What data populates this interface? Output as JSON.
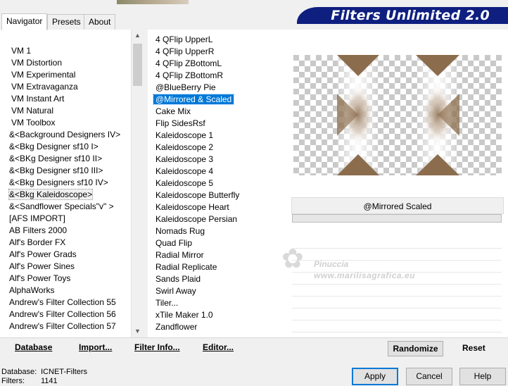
{
  "tabs": [
    {
      "label": "Navigator"
    },
    {
      "label": "Presets"
    },
    {
      "label": "About"
    }
  ],
  "app_title": "Filters Unlimited 2.0",
  "categories": [
    "VM 1",
    "VM Distortion",
    "VM Experimental",
    "VM Extravaganza",
    "VM Instant Art",
    "VM Natural",
    "VM Toolbox",
    "&<Background Designers IV>",
    "&<Bkg Designer sf10 I>",
    "&<BKg Designer sf10 II>",
    "&<Bkg Designer sf10 III>",
    "&<Bkg Designers sf10 IV>",
    "&<Bkg Kaleidoscope>",
    "&<Sandflower Specials\"v\" >",
    "[AFS IMPORT]",
    "AB Filters 2000",
    "Alf's Border FX",
    "Alf's Power Grads",
    "Alf's Power Sines",
    "Alf's Power Toys",
    "AlphaWorks",
    "Andrew's Filter Collection 55",
    "Andrew's Filter Collection 56",
    "Andrew's Filter Collection 57"
  ],
  "selected_category": "&<Bkg Kaleidoscope>",
  "filters": [
    "4 QFlip UpperL",
    "4 QFlip UpperR",
    "4 QFlip ZBottomL",
    "4 QFlip ZBottomR",
    "@BlueBerry Pie",
    "@Mirrored & Scaled",
    "Cake Mix",
    "Flip SidesRsf",
    "Kaleidoscope 1",
    "Kaleidoscope 2",
    "Kaleidoscope 3",
    "Kaleidoscope 4",
    "Kaleidoscope 5",
    "Kaleidoscope Butterfly",
    "Kaleidoscope Heart",
    "Kaleidoscope Persian",
    "Nomads Rug",
    "Quad Flip",
    "Radial Mirror",
    "Radial Replicate",
    "Sands Plaid",
    "Swirl Away",
    "Tiler...",
    "xTile Maker 1.0",
    "Zandflower"
  ],
  "selected_filter": "@Mirrored & Scaled",
  "preview_caption": "@Mirrored  Scaled",
  "watermark": {
    "name": "Pinuccia",
    "url": "www.marilisagrafica.eu"
  },
  "bottom_links": {
    "database": "Database",
    "import": "Import...",
    "filter_info": "Filter Info...",
    "editor": "Editor..."
  },
  "randomize_label": "Randomize",
  "reset_label": "Reset",
  "status": {
    "database_label": "Database:",
    "database_value": "ICNET-Filters",
    "filters_label": "Filters:",
    "filters_value": "1141"
  },
  "buttons": {
    "apply": "Apply",
    "cancel": "Cancel",
    "help": "Help"
  },
  "colors": {
    "accent": "#0078d7",
    "banner": "#0e1f80",
    "tile_brown": "#8b6c4c"
  }
}
